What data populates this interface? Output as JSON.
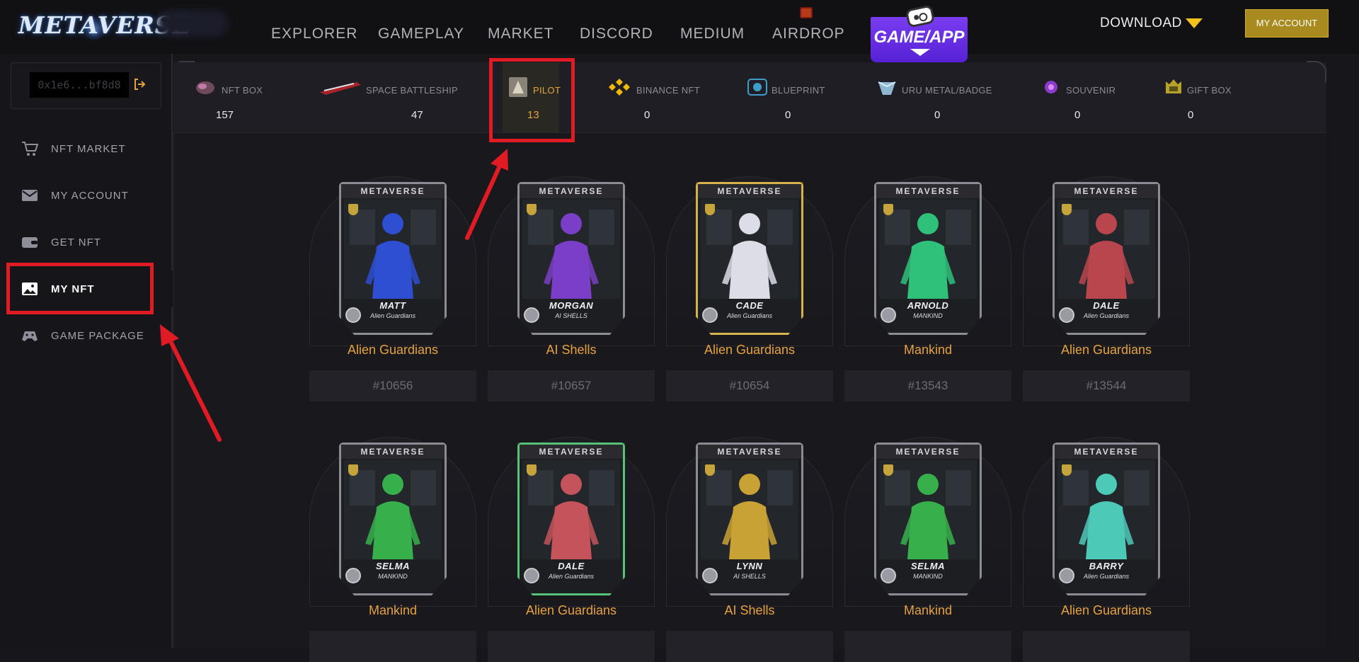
{
  "brand": {
    "logo_text": "METAVERSE"
  },
  "nav": {
    "items": [
      "EXPLORER",
      "GAMEPLAY",
      "MARKET",
      "DISCORD",
      "MEDIUM",
      "AIRDROP"
    ],
    "gameapp_label": "GAME/APP",
    "download_label": "DOWNLOAD",
    "my_account_label": "MY ACCOUNT"
  },
  "wallet": {
    "address": "0x1e6...bf8d8"
  },
  "sidebar": {
    "items": [
      {
        "label": "NFT MARKET",
        "icon": "cart-icon"
      },
      {
        "label": "MY ACCOUNT",
        "icon": "envelope-icon"
      },
      {
        "label": "GET NFT",
        "icon": "wallet-icon"
      },
      {
        "label": "MY NFT",
        "icon": "image-icon",
        "active": true
      },
      {
        "label": "GAME PACKAGE",
        "icon": "gamepad-icon"
      }
    ]
  },
  "tabs": [
    {
      "label": "NFT BOX",
      "count": "157",
      "icon": "nft-box-icon"
    },
    {
      "label": "SPACE BATTLESHIP",
      "count": "47",
      "icon": "battleship-icon"
    },
    {
      "label": "PILOT",
      "count": "13",
      "icon": "pilot-icon",
      "active": true
    },
    {
      "label": "BINANCE NFT",
      "count": "0",
      "icon": "binance-icon"
    },
    {
      "label": "BLUEPRINT",
      "count": "0",
      "icon": "blueprint-icon"
    },
    {
      "label": "URU METAL/BADGE",
      "count": "0",
      "icon": "uru-metal-icon"
    },
    {
      "label": "SOUVENIR",
      "count": "0",
      "icon": "souvenir-icon"
    },
    {
      "label": "GIFT BOX",
      "count": "0",
      "icon": "gift-box-icon"
    }
  ],
  "cards": [
    {
      "brand": "METAVERSE",
      "name": "MATT",
      "faction": "Alien Guardians",
      "title": "Alien Guardians",
      "id": "#10656",
      "frame": "silver",
      "color": "#2e4fd1"
    },
    {
      "brand": "METAVERSE",
      "name": "MORGAN",
      "faction": "AI SHELLS",
      "title": "AI Shells",
      "id": "#10657",
      "frame": "silver",
      "color": "#7b3fc7"
    },
    {
      "brand": "METAVERSE",
      "name": "CADE",
      "faction": "Alien Guardians",
      "title": "Alien Guardians",
      "id": "#10654",
      "frame": "gold",
      "color": "#dcdde6"
    },
    {
      "brand": "METAVERSE",
      "name": "ARNOLD",
      "faction": "MANKIND",
      "title": "Mankind",
      "id": "#13543",
      "frame": "silver",
      "color": "#2fc07a"
    },
    {
      "brand": "METAVERSE",
      "name": "DALE",
      "faction": "Alien Guardians",
      "title": "Alien Guardians",
      "id": "#13544",
      "frame": "silver",
      "color": "#b8464c"
    },
    {
      "brand": "METAVERSE",
      "name": "SELMA",
      "faction": "MANKIND",
      "title": "Mankind",
      "id": "",
      "frame": "silver",
      "color": "#37b04c"
    },
    {
      "brand": "METAVERSE",
      "name": "DALE",
      "faction": "Alien Guardians",
      "title": "Alien Guardians",
      "id": "",
      "frame": "green",
      "color": "#c4535b"
    },
    {
      "brand": "METAVERSE",
      "name": "LYNN",
      "faction": "AI SHELLS",
      "title": "AI Shells",
      "id": "",
      "frame": "silver",
      "color": "#c9a235"
    },
    {
      "brand": "METAVERSE",
      "name": "SELMA",
      "faction": "MANKIND",
      "title": "Mankind",
      "id": "",
      "frame": "silver",
      "color": "#37b04c"
    },
    {
      "brand": "METAVERSE",
      "name": "BARRY",
      "faction": "Alien Guardians",
      "title": "Alien Guardians",
      "id": "",
      "frame": "silver",
      "color": "#4dc9b8"
    }
  ],
  "colors": {
    "accent_gold": "#e3a33a",
    "highlight_red": "#e11b23",
    "gameapp_purple": "#6a2ee8"
  }
}
